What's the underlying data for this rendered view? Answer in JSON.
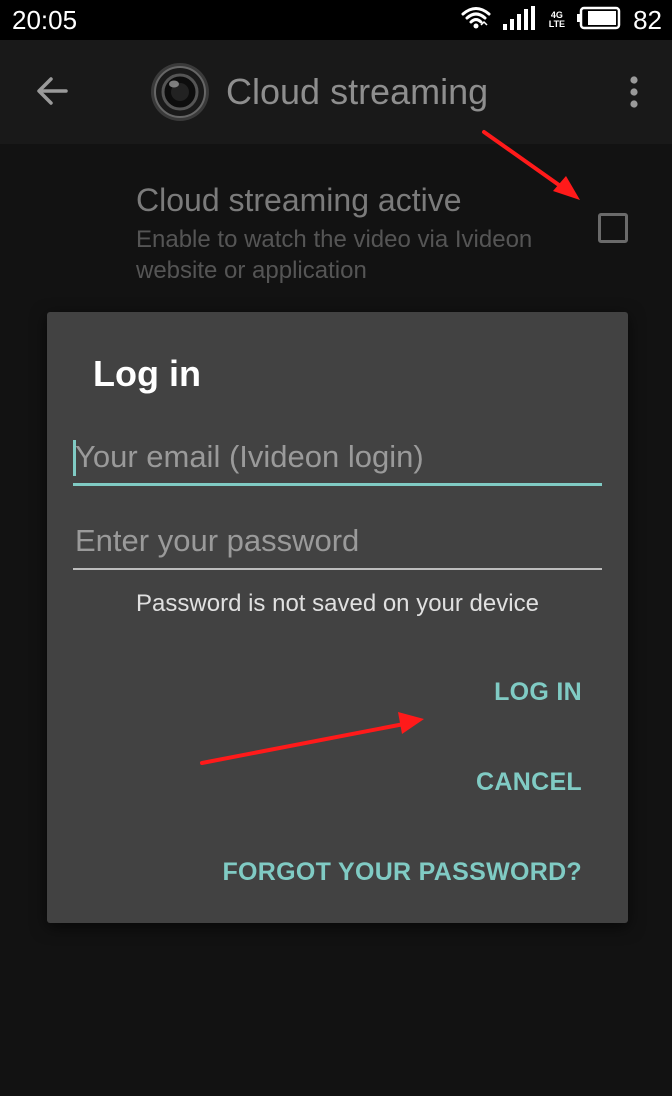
{
  "status_bar": {
    "time": "20:05",
    "network_top": "4G",
    "network_bottom": "LTE",
    "battery_level": "82",
    "icons": [
      "wifi-icon",
      "signal-icon",
      "battery-icon"
    ]
  },
  "app_bar": {
    "title": "Cloud streaming",
    "back_icon": "arrow-left-icon",
    "logo_icon": "camera-lens-icon",
    "menu_icon": "more-vert-icon"
  },
  "setting": {
    "title": "Cloud streaming active",
    "summary": "Enable to watch the video via Ivideon website or application",
    "checked": false
  },
  "dialog": {
    "title": "Log in",
    "email_placeholder": "Your email (Ivideon login)",
    "email_value": "",
    "password_placeholder": "Enter your password",
    "password_value": "",
    "note": "Password is not saved on your device",
    "login_label": "LOG IN",
    "cancel_label": "CANCEL",
    "forgot_label": "FORGOT YOUR PASSWORD?"
  },
  "colors": {
    "accent": "#80cbc4",
    "dialog_background": "#424242",
    "page_background": "#121212",
    "annotation": "#ff1a1a"
  }
}
